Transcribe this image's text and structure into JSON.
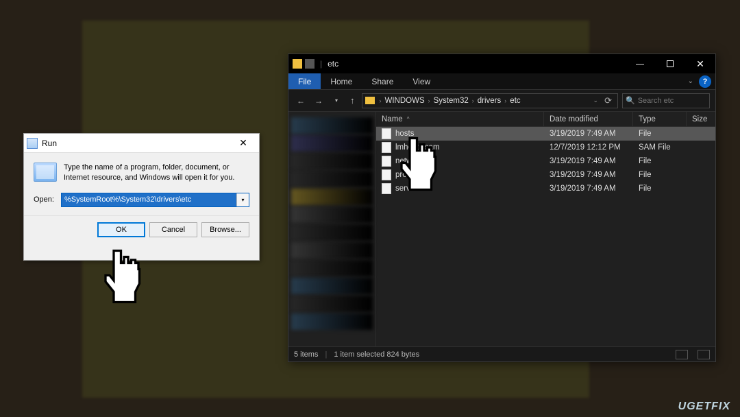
{
  "run": {
    "title": "Run",
    "description": "Type the name of a program, folder, document, or Internet resource, and Windows will open it for you.",
    "open_label": "Open:",
    "input_value": "%SystemRoot%\\System32\\drivers\\etc",
    "ok_label": "OK",
    "cancel_label": "Cancel",
    "browse_label": "Browse...",
    "close_glyph": "✕"
  },
  "explorer": {
    "title": "etc",
    "ribbon": {
      "file": "File",
      "tabs": [
        "Home",
        "Share",
        "View"
      ],
      "help_glyph": "?"
    },
    "window_controls": {
      "minimize": "—",
      "close": "✕"
    },
    "nav": {
      "back": "←",
      "forward": "→",
      "dropdown": "▾",
      "up": "↑",
      "refresh": "⟳"
    },
    "path_segments": [
      "WINDOWS",
      "System32",
      "drivers",
      "etc"
    ],
    "path_sep": "›",
    "search_placeholder": "Search etc",
    "columns": {
      "name": "Name",
      "date": "Date modified",
      "type": "Type",
      "size": "Size",
      "sort_glyph": "^"
    },
    "rows": [
      {
        "name": "hosts",
        "date": "3/19/2019 7:49 AM",
        "type": "File",
        "selected": true
      },
      {
        "name": "lmhosts.sam",
        "date": "12/7/2019 12:12 PM",
        "type": "SAM File",
        "selected": false
      },
      {
        "name": "networks",
        "date": "3/19/2019 7:49 AM",
        "type": "File",
        "selected": false
      },
      {
        "name": "protocol",
        "date": "3/19/2019 7:49 AM",
        "type": "File",
        "selected": false
      },
      {
        "name": "services",
        "date": "3/19/2019 7:49 AM",
        "type": "File",
        "selected": false
      }
    ],
    "status": {
      "count": "5 items",
      "selection": "1 item selected  824 bytes"
    }
  },
  "watermark": "UGETFIX"
}
